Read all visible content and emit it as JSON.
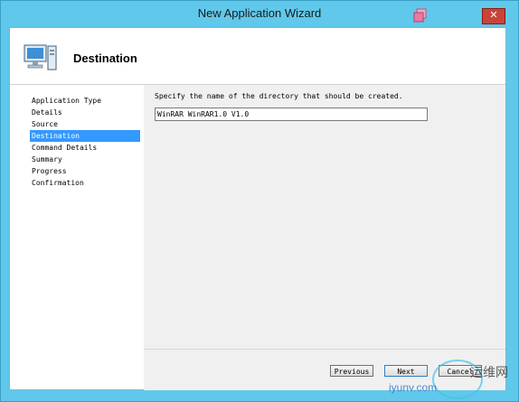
{
  "window": {
    "title": "New Application Wizard",
    "close_glyph": "✕"
  },
  "banner": {
    "title": "Destination",
    "icon": "computer-icon"
  },
  "nav": {
    "items": [
      {
        "label": "Application Type",
        "selected": false
      },
      {
        "label": "Details",
        "selected": false
      },
      {
        "label": "Source",
        "selected": false
      },
      {
        "label": "Destination",
        "selected": true
      },
      {
        "label": "Command Details",
        "selected": false
      },
      {
        "label": "Summary",
        "selected": false
      },
      {
        "label": "Progress",
        "selected": false
      },
      {
        "label": "Confirmation",
        "selected": false
      }
    ]
  },
  "main": {
    "prompt": "Specify the name of the directory that should be created.",
    "directory_value": "WinRAR WinRAR1.0 V1.0"
  },
  "buttons": {
    "previous": "Previous",
    "next": "Next",
    "cancel": "Cancel"
  },
  "watermark": {
    "top": "运维网",
    "bottom": "iyunv.com"
  },
  "colors": {
    "titlebar": "#60c8ea",
    "selection": "#3399ff",
    "close": "#c7443a"
  }
}
